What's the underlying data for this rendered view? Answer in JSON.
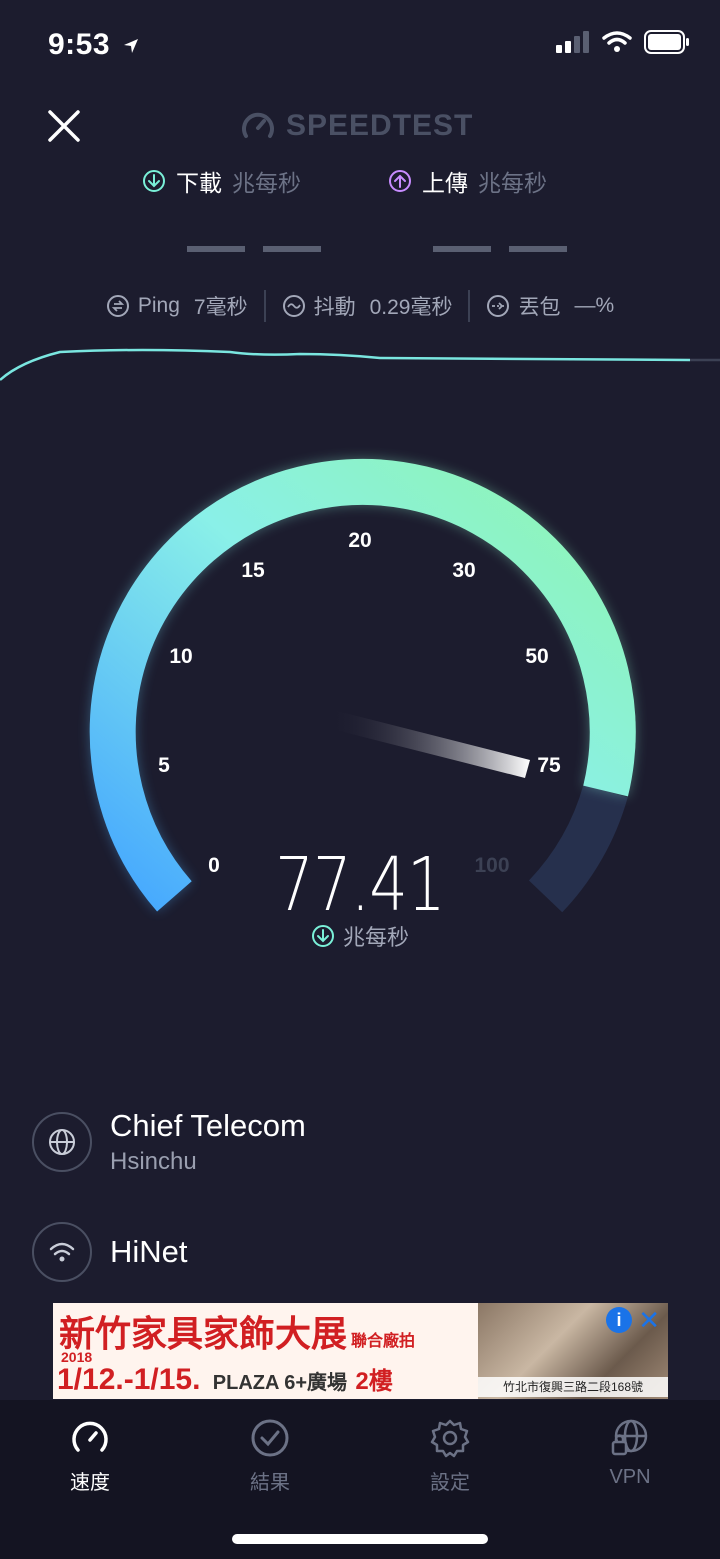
{
  "status": {
    "time": "9:53"
  },
  "header": {
    "brand": "SPEEDTEST"
  },
  "metrics": {
    "download": {
      "label": "下載",
      "unit": "兆每秒"
    },
    "upload": {
      "label": "上傳",
      "unit": "兆每秒"
    }
  },
  "ping": {
    "ping_label": "Ping",
    "ping_value": "7毫秒",
    "jitter_label": "抖動",
    "jitter_value": "0.29毫秒",
    "loss_label": "丟包",
    "loss_value": "—%"
  },
  "gauge": {
    "ticks": [
      "0",
      "5",
      "10",
      "15",
      "20",
      "30",
      "50",
      "75",
      "100"
    ],
    "value": "77.41",
    "unit": "兆每秒",
    "colors": {
      "start": "#4aa8ff",
      "mid": "#8af0e8",
      "end": "#8ff5b0",
      "track": "#26304d"
    }
  },
  "server": {
    "name": "Chief Telecom",
    "location": "Hsinchu"
  },
  "isp": {
    "name": "HiNet"
  },
  "ad": {
    "title": "新竹家具家飾大展",
    "tag": "聯合廠拍",
    "year": "2018",
    "dates": "1/12.-1/15.",
    "venue": "PLAZA 6+廣場",
    "floor": "2樓",
    "address": "竹北市復興三路二段168號"
  },
  "tabs": [
    {
      "label": "速度",
      "icon": "gauge-icon"
    },
    {
      "label": "結果",
      "icon": "check-circle-icon"
    },
    {
      "label": "設定",
      "icon": "gear-icon"
    },
    {
      "label": "VPN",
      "icon": "globe-lock-icon"
    }
  ]
}
